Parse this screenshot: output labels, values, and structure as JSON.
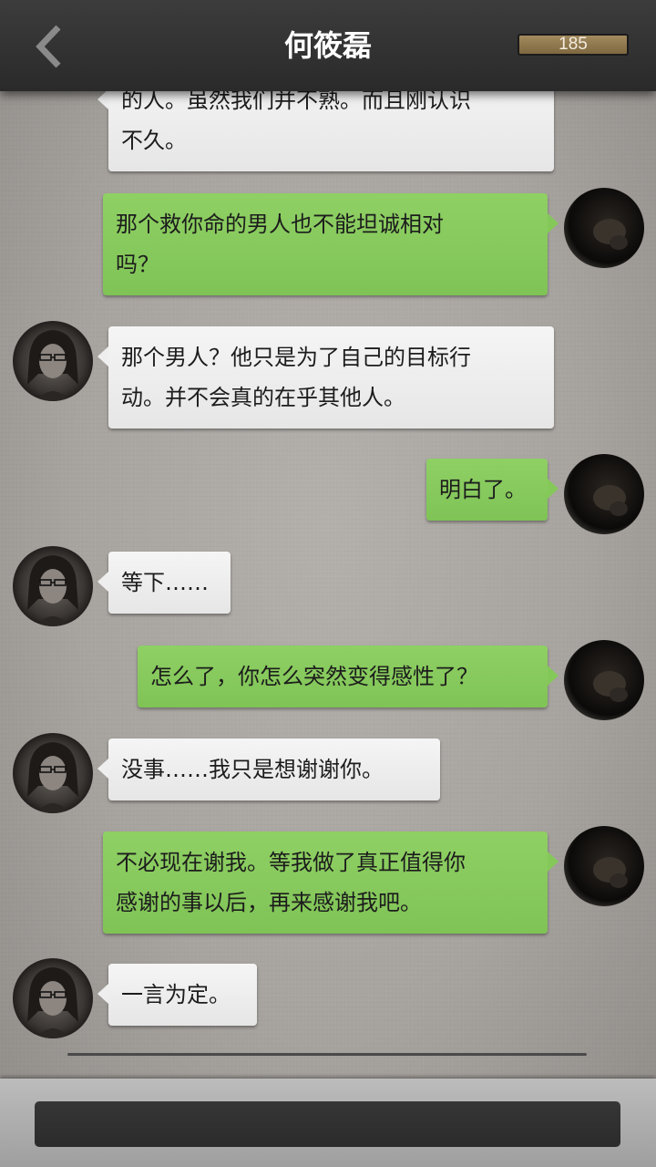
{
  "header": {
    "back_icon": "chevron-left-icon",
    "title": "何筱磊",
    "counter": "185"
  },
  "messages": [
    {
      "side": "partner",
      "text_lines": [
        "的人。虽然我们并不熟。而且刚认识",
        "不久。"
      ]
    },
    {
      "side": "self",
      "text_lines": [
        "那个救你命的男人也不能坦诚相对",
        "吗？"
      ]
    },
    {
      "side": "partner",
      "text_lines": [
        "那个男人？他只是为了自己的目标行",
        "动。并不会真的在乎其他人。"
      ]
    },
    {
      "side": "self",
      "text_lines": [
        "明白了。"
      ]
    },
    {
      "side": "partner",
      "text_lines": [
        "等下……"
      ]
    },
    {
      "side": "self",
      "text_lines": [
        "怎么了，你怎么突然变得感性了？"
      ]
    },
    {
      "side": "partner",
      "text_lines": [
        "没事……我只是想谢谢你。"
      ]
    },
    {
      "side": "self",
      "text_lines": [
        "不必现在谢我。等我做了真正值得你",
        "感谢的事以后，再来感谢我吧。"
      ]
    },
    {
      "side": "partner",
      "text_lines": [
        "一言为定。"
      ]
    }
  ],
  "colors": {
    "header_bg": "#2f2f2f",
    "incoming_bubble": "#eeeeee",
    "outgoing_bubble": "#85c85a",
    "counter_bg": "#947b50"
  }
}
